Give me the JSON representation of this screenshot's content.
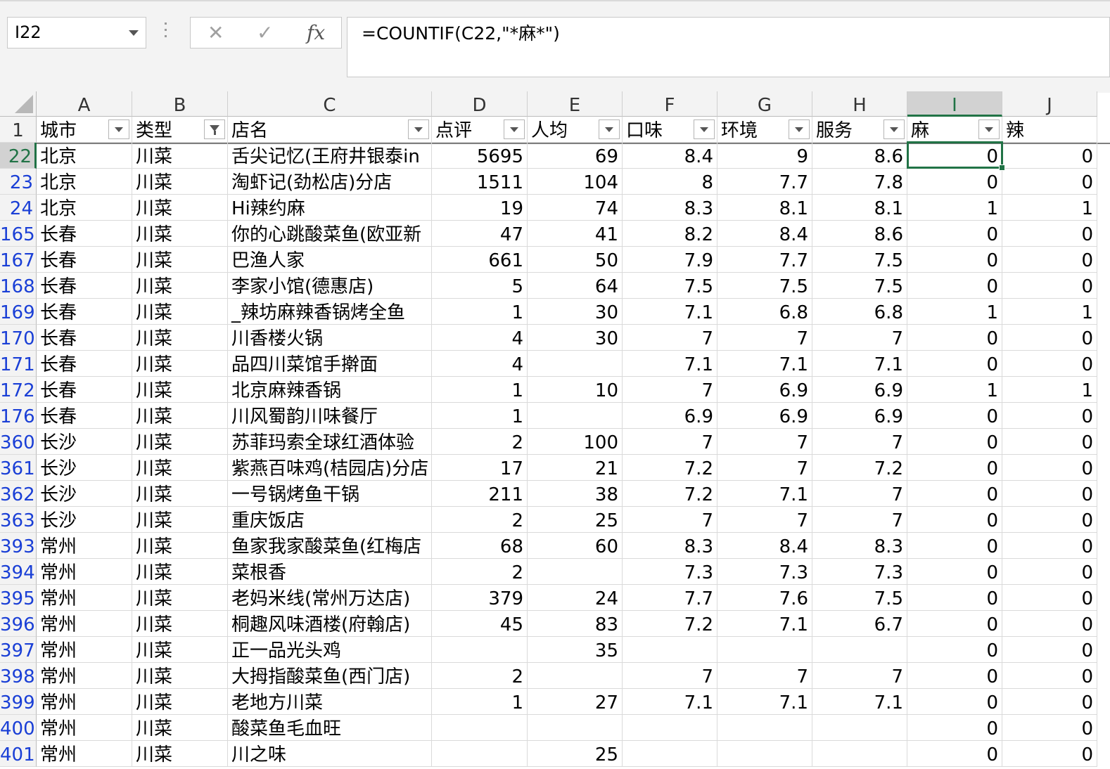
{
  "name_box": "I22",
  "formula_icons": [
    "cancel-icon",
    "enter-icon",
    "function-icon"
  ],
  "formula_bar": {
    "fx_label": "fx",
    "formula": "=COUNTIF(C22,\"*麻*\")"
  },
  "columns": [
    "A",
    "B",
    "C",
    "D",
    "E",
    "F",
    "G",
    "H",
    "I",
    "J"
  ],
  "selected_column": "I",
  "header_row": {
    "row_number": "1",
    "cells": [
      "城市",
      "类型",
      "店名",
      "点评",
      "人均",
      "口味",
      "环境",
      "服务",
      "麻",
      "辣"
    ],
    "filter_active_column": "B"
  },
  "rows": [
    {
      "n": "22",
      "city": "北京",
      "type": "川菜",
      "name": "舌尖记忆(王府井银泰in",
      "reviews": "5695",
      "avg": "69",
      "taste": "8.4",
      "env": "9",
      "svc": "8.6",
      "ma": "0",
      "la": "0"
    },
    {
      "n": "23",
      "city": "北京",
      "type": "川菜",
      "name": "淘虾记(劲松店)分店",
      "reviews": "1511",
      "avg": "104",
      "taste": "8",
      "env": "7.7",
      "svc": "7.8",
      "ma": "0",
      "la": "0"
    },
    {
      "n": "24",
      "city": "北京",
      "type": "川菜",
      "name": "Hi辣约麻",
      "reviews": "19",
      "avg": "74",
      "taste": "8.3",
      "env": "8.1",
      "svc": "8.1",
      "ma": "1",
      "la": "1"
    },
    {
      "n": "165",
      "city": "长春",
      "type": "川菜",
      "name": "你的心跳酸菜鱼(欧亚新",
      "reviews": "47",
      "avg": "41",
      "taste": "8.2",
      "env": "8.4",
      "svc": "8.6",
      "ma": "0",
      "la": "0"
    },
    {
      "n": "167",
      "city": "长春",
      "type": "川菜",
      "name": "巴渔人家",
      "reviews": "661",
      "avg": "50",
      "taste": "7.9",
      "env": "7.7",
      "svc": "7.5",
      "ma": "0",
      "la": "0"
    },
    {
      "n": "168",
      "city": "长春",
      "type": "川菜",
      "name": "李家小馆(德惠店)",
      "reviews": "5",
      "avg": "64",
      "taste": "7.5",
      "env": "7.5",
      "svc": "7.5",
      "ma": "0",
      "la": "0"
    },
    {
      "n": "169",
      "city": "长春",
      "type": "川菜",
      "name": "_辣坊麻辣香锅烤全鱼",
      "reviews": "1",
      "avg": "30",
      "taste": "7.1",
      "env": "6.8",
      "svc": "6.8",
      "ma": "1",
      "la": "1"
    },
    {
      "n": "170",
      "city": "长春",
      "type": "川菜",
      "name": "川香楼火锅",
      "reviews": "4",
      "avg": "30",
      "taste": "7",
      "env": "7",
      "svc": "7",
      "ma": "0",
      "la": "0"
    },
    {
      "n": "171",
      "city": "长春",
      "type": "川菜",
      "name": "品四川菜馆手擀面",
      "reviews": "4",
      "avg": "",
      "taste": "7.1",
      "env": "7.1",
      "svc": "7.1",
      "ma": "0",
      "la": "0"
    },
    {
      "n": "172",
      "city": "长春",
      "type": "川菜",
      "name": "北京麻辣香锅",
      "reviews": "1",
      "avg": "10",
      "taste": "7",
      "env": "6.9",
      "svc": "6.9",
      "ma": "1",
      "la": "1"
    },
    {
      "n": "176",
      "city": "长春",
      "type": "川菜",
      "name": "川风蜀韵川味餐厅",
      "reviews": "1",
      "avg": "",
      "taste": "6.9",
      "env": "6.9",
      "svc": "6.9",
      "ma": "0",
      "la": "0"
    },
    {
      "n": "360",
      "city": "长沙",
      "type": "川菜",
      "name": "苏菲玛索全球红酒体验",
      "reviews": "2",
      "avg": "100",
      "taste": "7",
      "env": "7",
      "svc": "7",
      "ma": "0",
      "la": "0"
    },
    {
      "n": "361",
      "city": "长沙",
      "type": "川菜",
      "name": "紫燕百味鸡(桔园店)分店",
      "reviews": "17",
      "avg": "21",
      "taste": "7.2",
      "env": "7",
      "svc": "7.2",
      "ma": "0",
      "la": "0"
    },
    {
      "n": "362",
      "city": "长沙",
      "type": "川菜",
      "name": "一号锅烤鱼干锅",
      "reviews": "211",
      "avg": "38",
      "taste": "7.2",
      "env": "7.1",
      "svc": "7",
      "ma": "0",
      "la": "0"
    },
    {
      "n": "363",
      "city": "长沙",
      "type": "川菜",
      "name": "重庆饭店",
      "reviews": "2",
      "avg": "25",
      "taste": "7",
      "env": "7",
      "svc": "7",
      "ma": "0",
      "la": "0"
    },
    {
      "n": "393",
      "city": "常州",
      "type": "川菜",
      "name": "鱼家我家酸菜鱼(红梅店",
      "reviews": "68",
      "avg": "60",
      "taste": "8.3",
      "env": "8.4",
      "svc": "8.3",
      "ma": "0",
      "la": "0"
    },
    {
      "n": "394",
      "city": "常州",
      "type": "川菜",
      "name": "菜根香",
      "reviews": "2",
      "avg": "",
      "taste": "7.3",
      "env": "7.3",
      "svc": "7.3",
      "ma": "0",
      "la": "0"
    },
    {
      "n": "395",
      "city": "常州",
      "type": "川菜",
      "name": "老妈米线(常州万达店)",
      "reviews": "379",
      "avg": "24",
      "taste": "7.7",
      "env": "7.6",
      "svc": "7.5",
      "ma": "0",
      "la": "0"
    },
    {
      "n": "396",
      "city": "常州",
      "type": "川菜",
      "name": "桐趣风味酒楼(府翰店)",
      "reviews": "45",
      "avg": "83",
      "taste": "7.2",
      "env": "7.1",
      "svc": "6.7",
      "ma": "0",
      "la": "0"
    },
    {
      "n": "397",
      "city": "常州",
      "type": "川菜",
      "name": "正一品光头鸡",
      "reviews": "",
      "avg": "35",
      "taste": "",
      "env": "",
      "svc": "",
      "ma": "0",
      "la": "0"
    },
    {
      "n": "398",
      "city": "常州",
      "type": "川菜",
      "name": "大拇指酸菜鱼(西门店)",
      "reviews": "2",
      "avg": "",
      "taste": "7",
      "env": "7",
      "svc": "7",
      "ma": "0",
      "la": "0"
    },
    {
      "n": "399",
      "city": "常州",
      "type": "川菜",
      "name": "老地方川菜",
      "reviews": "1",
      "avg": "27",
      "taste": "7.1",
      "env": "7.1",
      "svc": "7.1",
      "ma": "0",
      "la": "0"
    },
    {
      "n": "400",
      "city": "常州",
      "type": "川菜",
      "name": "酸菜鱼毛血旺",
      "reviews": "",
      "avg": "",
      "taste": "",
      "env": "",
      "svc": "",
      "ma": "0",
      "la": "0"
    },
    {
      "n": "401",
      "city": "常州",
      "type": "川菜",
      "name": "川之味",
      "reviews": "",
      "avg": "25",
      "taste": "",
      "env": "",
      "svc": "",
      "ma": "0",
      "la": "0"
    }
  ]
}
